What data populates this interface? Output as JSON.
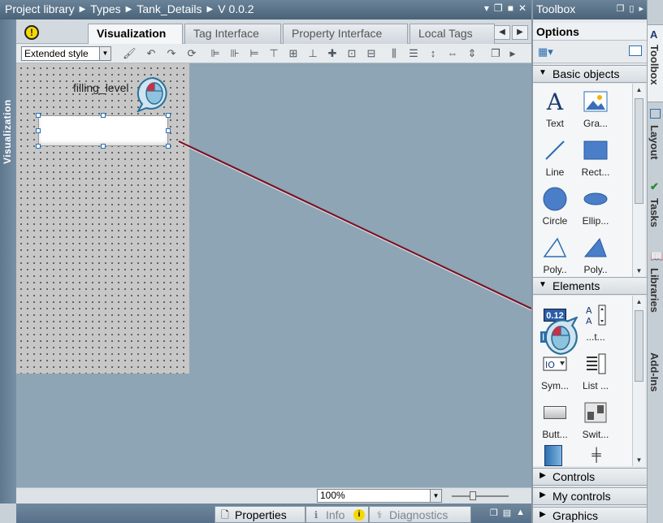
{
  "title_bar": {
    "crumbs": [
      "Project library",
      "Types",
      "Tank_Details",
      "V 0.0.2"
    ],
    "controls": [
      "▾",
      "❐",
      "■",
      "✕"
    ]
  },
  "left_tab": {
    "label": "Visualization"
  },
  "tabs": [
    {
      "label": "Visualization",
      "active": true
    },
    {
      "label": "Tag Interface",
      "active": false
    },
    {
      "label": "Property Interface",
      "active": false
    },
    {
      "label": "Local Tags",
      "active": false
    }
  ],
  "toolbar": {
    "style_select": "Extended style"
  },
  "canvas": {
    "label_text": "filling_level",
    "background": "#8da5b5"
  },
  "status_bar": {
    "zoom": "100%"
  },
  "bottom_tabs": [
    {
      "label": "Properties",
      "icon": "properties-icon"
    },
    {
      "label": "Info",
      "icon": "info-icon"
    },
    {
      "label": "Diagnostics",
      "icon": "diagnostics-icon"
    }
  ],
  "toolbox": {
    "title": "Toolbox",
    "options": "Options",
    "sections": {
      "basic_objects": {
        "title": "Basic objects",
        "items": [
          "Text",
          "Gra...",
          "Line",
          "Rect...",
          "Circle",
          "Ellip...",
          "Poly..",
          "Poly.."
        ]
      },
      "elements": {
        "title": "Elements",
        "items": [
          "IO fi...",
          "...t...",
          "Sym...",
          "List ...",
          "Butt...",
          "Swit..."
        ],
        "io_display": "0.12"
      },
      "controls": {
        "title": "Controls"
      },
      "my_controls": {
        "title": "My controls"
      },
      "graphics": {
        "title": "Graphics"
      }
    }
  },
  "right_tabs": [
    "Toolbox",
    "Layout",
    "Tasks",
    "Libraries",
    "Add-Ins"
  ],
  "colors": {
    "accent": "#2b6fb0",
    "connector_line": "#7a1020"
  }
}
